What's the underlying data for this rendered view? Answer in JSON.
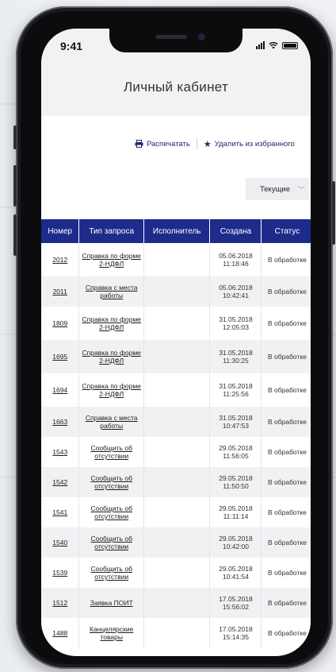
{
  "status_bar": {
    "time": "9:41"
  },
  "header": {
    "title": "Личный кабинет"
  },
  "actions": {
    "print_label": "Распечатать",
    "unfavorite_label": "Удалить из избранного"
  },
  "filter": {
    "selected": "Текущие"
  },
  "table": {
    "columns": [
      "Номер",
      "Тип запроса",
      "Исполнитель",
      "Создана",
      "Статус"
    ],
    "rows": [
      {
        "number": "2012",
        "type": "Справка по форме 2-НДФЛ",
        "executor": "",
        "created_date": "05.06.2018",
        "created_time": "11:18:46",
        "status": "В обработке"
      },
      {
        "number": "2011",
        "type": "Справка с места работы",
        "executor": "",
        "created_date": "05.06.2018",
        "created_time": "10:42:41",
        "status": "В обработке"
      },
      {
        "number": "1809",
        "type": "Справка по форме 2-НДФЛ",
        "executor": "",
        "created_date": "31.05.2018",
        "created_time": "12:05:03",
        "status": "В обработке"
      },
      {
        "number": "1695",
        "type": "Справка по форме 2-НДФЛ",
        "executor": "",
        "created_date": "31.05.2018",
        "created_time": "11:30:25",
        "status": "В обработке"
      },
      {
        "number": "1694",
        "type": "Справка по форме 2-НДФЛ",
        "executor": "",
        "created_date": "31.05.2018",
        "created_time": "11:25:56",
        "status": "В обработке"
      },
      {
        "number": "1663",
        "type": "Справка с места работы",
        "executor": "",
        "created_date": "31.05.2018",
        "created_time": "10:47:53",
        "status": "В обработке"
      },
      {
        "number": "1543",
        "type": "Сообщить об отсутствии",
        "executor": "",
        "created_date": "29.05.2018",
        "created_time": "11:56:05",
        "status": "В обработке"
      },
      {
        "number": "1542",
        "type": "Сообщить об отсутствии",
        "executor": "",
        "created_date": "29.05.2018",
        "created_time": "11:50:50",
        "status": "В обработке"
      },
      {
        "number": "1541",
        "type": "Сообщить об отсутствии",
        "executor": "",
        "created_date": "29.05.2018",
        "created_time": "11:11:14",
        "status": "В обработке"
      },
      {
        "number": "1540",
        "type": "Сообщить об отсутствии",
        "executor": "",
        "created_date": "29.05.2018",
        "created_time": "10:42:00",
        "status": "В обработке"
      },
      {
        "number": "1539",
        "type": "Сообщить об отсутствии",
        "executor": "",
        "created_date": "29.05.2018",
        "created_time": "10:41:54",
        "status": "В обработке"
      },
      {
        "number": "1512",
        "type": "Заявка ПОИТ",
        "executor": "",
        "created_date": "17.05.2018",
        "created_time": "15:56:02",
        "status": "В обработке"
      },
      {
        "number": "1488",
        "type": "Канцелярские товары",
        "executor": "",
        "created_date": "17.05.2018",
        "created_time": "15:14:35",
        "status": "В обработке"
      }
    ]
  },
  "icons": {
    "print": "printer-icon",
    "favorite": "star-icon",
    "dropdown": "chevron-down-icon"
  },
  "colors": {
    "table_header": "#1d2b8b",
    "link": "#1d2b6b"
  }
}
